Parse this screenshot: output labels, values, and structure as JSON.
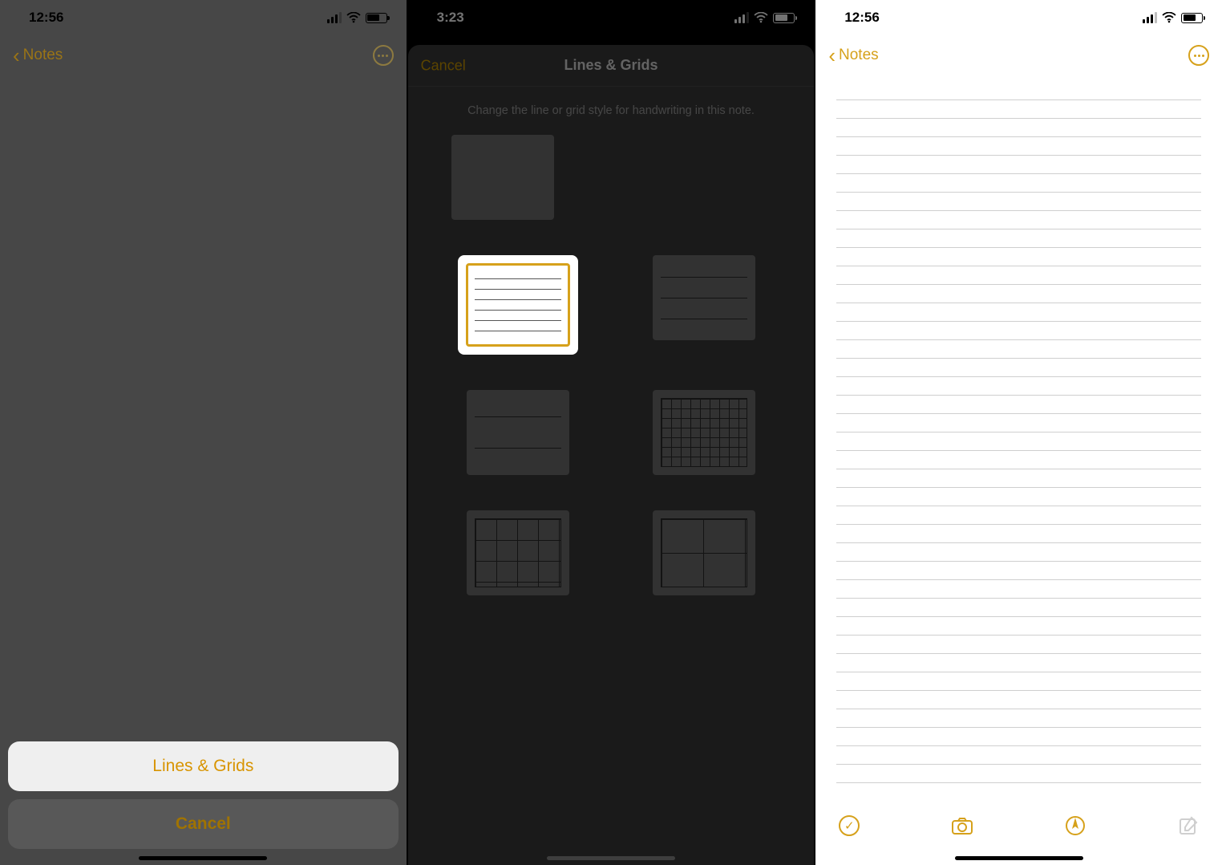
{
  "pane1": {
    "status_time": "12:56",
    "back_label": "Notes",
    "action_primary": "Lines & Grids",
    "action_cancel": "Cancel"
  },
  "pane2": {
    "status_time": "3:23",
    "modal_cancel": "Cancel",
    "modal_title": "Lines & Grids",
    "modal_description": "Change the line or grid style for handwriting in this note.",
    "swatches": [
      {
        "id": "blank",
        "label": "None"
      },
      {
        "id": "lines-narrow",
        "label": "Lines narrow",
        "selected": true
      },
      {
        "id": "lines-medium",
        "label": "Lines medium"
      },
      {
        "id": "lines-wide",
        "label": "Lines wide"
      },
      {
        "id": "grid-small",
        "label": "Grid small"
      },
      {
        "id": "grid-medium",
        "label": "Grid medium"
      },
      {
        "id": "grid-large",
        "label": "Grid large"
      }
    ]
  },
  "pane3": {
    "status_time": "12:56",
    "back_label": "Notes",
    "toolbar": {
      "checklist_label": "Checklist",
      "camera_label": "Camera",
      "draw_label": "Draw",
      "compose_label": "New Note"
    }
  }
}
